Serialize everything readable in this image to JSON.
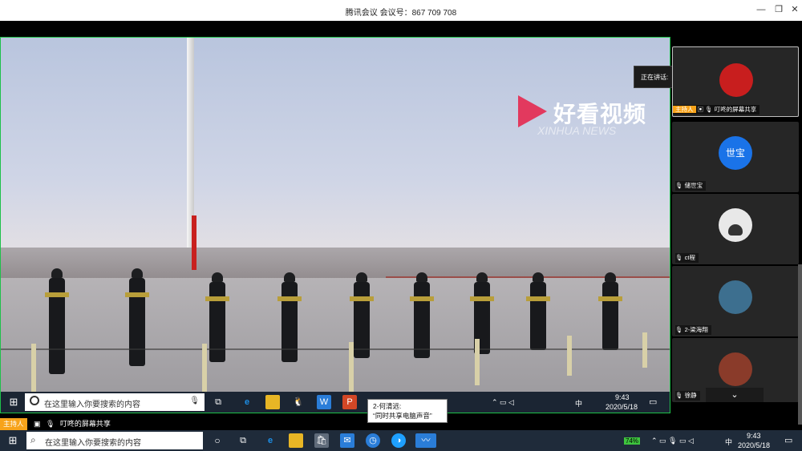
{
  "window": {
    "title": "腾讯会议 会议号：867 709 708",
    "min_label": "—",
    "max_label": "❐",
    "close_label": "✕"
  },
  "video": {
    "logo_text": "好看视频",
    "logo_sub": "XINHUA NEWS"
  },
  "shared_taskbar": {
    "search_placeholder": "在这里输入你要搜索的内容",
    "time": "9:43",
    "date": "2020/5/18",
    "ime_label": "中"
  },
  "tooltip": {
    "line1": "2-何清远:",
    "line2": "“同时共享电脑声音”"
  },
  "share_status": {
    "host_label": "主持人",
    "text": "叮咚的屏幕共享"
  },
  "participants": [
    {
      "avatar_text": "",
      "name": "叮咚的屏幕共享",
      "host": true,
      "avatar_color": "#c81e1e"
    },
    {
      "avatar_text": "世宝",
      "name": "储世宝",
      "host": false,
      "avatar_color": "#1a73e8"
    },
    {
      "avatar_text": "",
      "name": "ct程",
      "host": false,
      "avatar_color": "#e8e8e8"
    },
    {
      "avatar_text": "",
      "name": "2-梁海翔",
      "host": false,
      "avatar_color": "#3d6f8f"
    },
    {
      "avatar_text": "",
      "name": "徐静",
      "host": false,
      "avatar_color": "#8a3b2a"
    }
  ],
  "speaking_popup": {
    "label": "正在讲话:"
  },
  "taskbar": {
    "search_placeholder": "在这里输入你要搜索的内容",
    "time": "9:43",
    "date": "2020/5/18",
    "battery": "74%",
    "ime_label": "中"
  }
}
